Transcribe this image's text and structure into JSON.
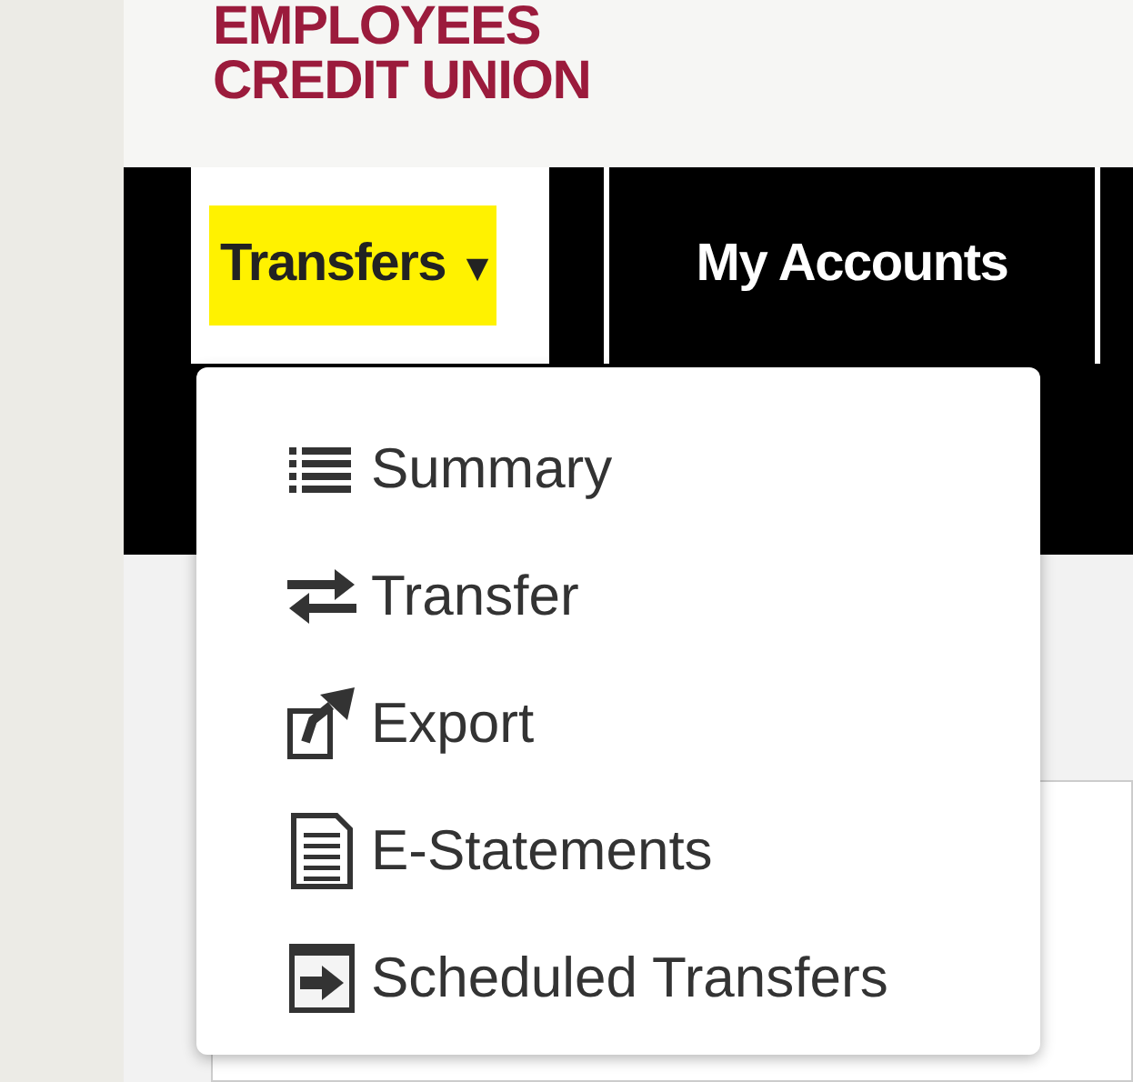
{
  "logo": {
    "line_1": "EMPLOYEES",
    "line_2": "CREDIT UNION"
  },
  "tabs": [
    {
      "label": "Transfers",
      "selected": true,
      "highlighted": true,
      "expanded": true,
      "caret": "▾"
    },
    {
      "label": "My Accounts",
      "selected": false,
      "highlighted": false
    }
  ],
  "menu": [
    {
      "label": "Summary",
      "kind": "list"
    },
    {
      "label": "Transfer",
      "kind": "swap"
    },
    {
      "label": "Export",
      "kind": "export"
    },
    {
      "label": "E-Statements",
      "kind": "document"
    },
    {
      "label": "Scheduled Transfers",
      "kind": "schedule"
    }
  ]
}
